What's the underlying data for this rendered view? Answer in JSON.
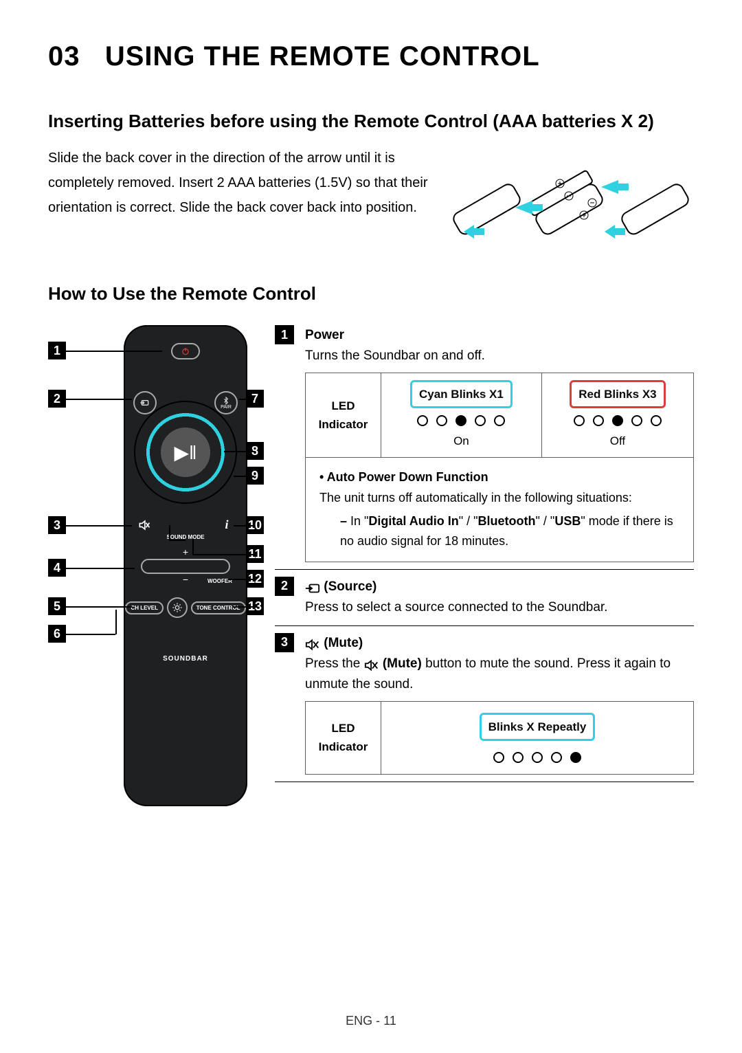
{
  "chapter_number": "03",
  "chapter_title": "USING THE REMOTE CONTROL",
  "section_batteries": {
    "title": "Inserting Batteries before using the Remote Control (AAA batteries X 2)",
    "text": "Slide the back cover in the direction of the arrow until it is completely removed. Insert 2 AAA batteries (1.5V) so that their orientation is correct. Slide the back cover back into position."
  },
  "section_howto": {
    "title": "How to Use the Remote Control"
  },
  "remote": {
    "pair_label": "PAIR",
    "sound_mode_label": "SOUND MODE",
    "woofer_label": "WOOFER",
    "ch_level_label": "CH LEVEL",
    "tone_control_label": "TONE CONTROL",
    "brand": "SOUNDBAR",
    "callouts_left": [
      "1",
      "2",
      "3",
      "4",
      "5",
      "6"
    ],
    "callouts_right": [
      "7",
      "8",
      "9",
      "10",
      "11",
      "12",
      "13"
    ]
  },
  "descriptions": {
    "power": {
      "num": "1",
      "title": "Power",
      "text": "Turns the Soundbar on and off.",
      "led_row_label": "LED Indicator",
      "col1_title": "Cyan Blinks X1",
      "col1_state": "On",
      "col2_title": "Red Blinks X3",
      "col2_state": "Off",
      "note_title": "Auto Power Down Function",
      "note_text": "The unit turns off automatically in the following situations:",
      "note_sub_prefix": "In \"",
      "note_mode1": "Digital Audio In",
      "note_sep": "\" / \"",
      "note_mode2": "Bluetooth",
      "note_mode3": "USB",
      "note_sub_suffix": "\" mode if there is no audio signal for 18 minutes."
    },
    "source": {
      "num": "2",
      "title": "(Source)",
      "text": "Press to select a source connected to the Soundbar."
    },
    "mute": {
      "num": "3",
      "title": "(Mute)",
      "text_pre": "Press the ",
      "text_mid": " (Mute)",
      "text_post": " button to mute the sound. Press it again to unmute the sound.",
      "led_row_label": "LED Indicator",
      "col_title": "Blinks X Repeatly"
    }
  },
  "footer": "ENG - 11"
}
